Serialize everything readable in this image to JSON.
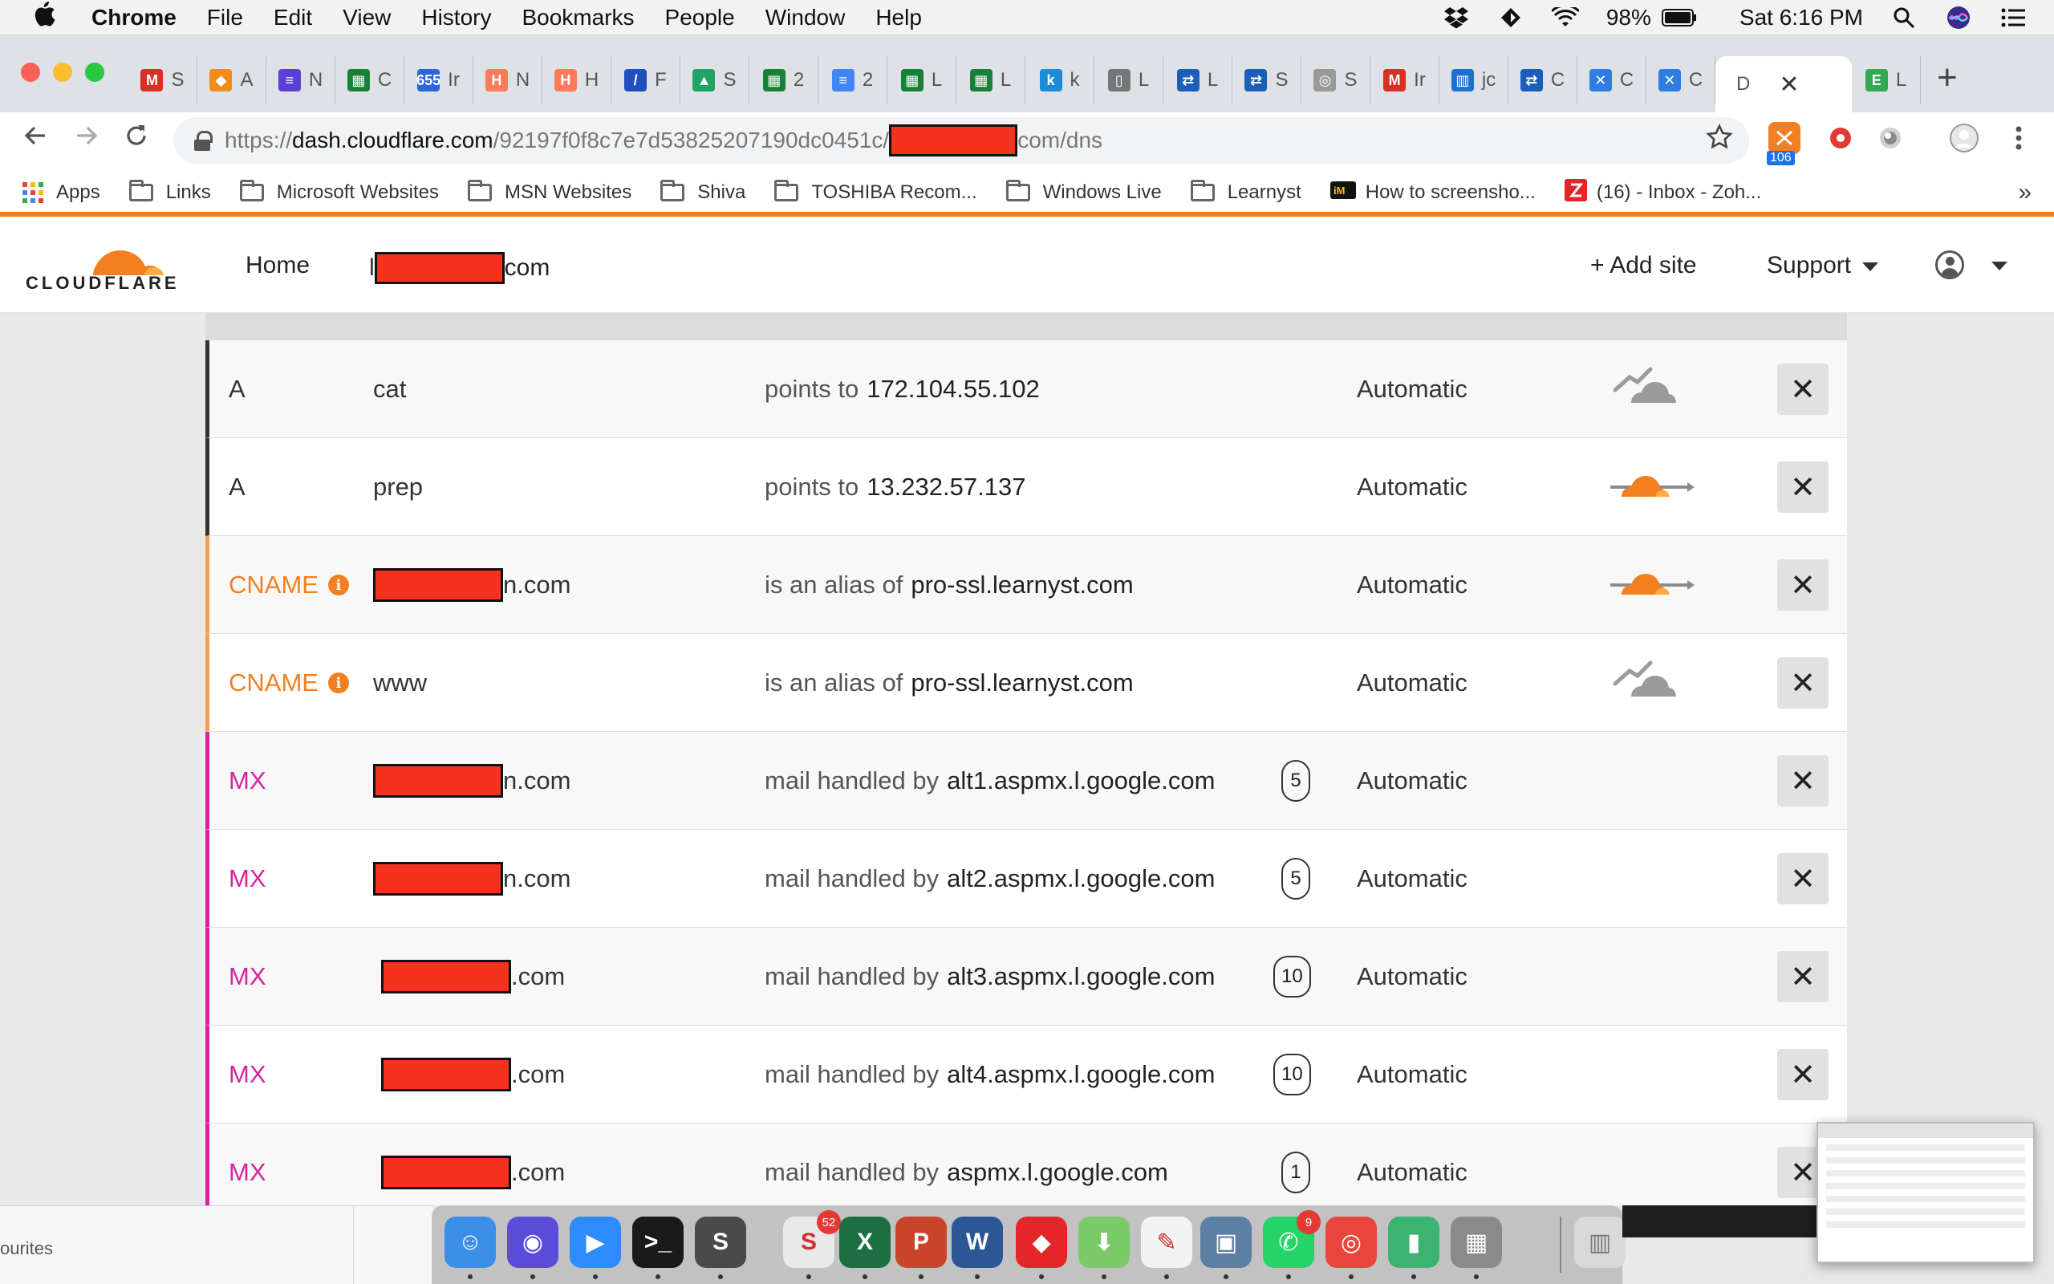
{
  "menubar": {
    "apple": "",
    "app": "Chrome",
    "items": [
      "File",
      "Edit",
      "View",
      "History",
      "Bookmarks",
      "People",
      "Window",
      "Help"
    ],
    "battery": "98%",
    "clock": "Sat 6:16 PM"
  },
  "tabs": [
    {
      "letter": "S",
      "fav": "M",
      "color": "#d93025"
    },
    {
      "letter": "A",
      "fav": "◆",
      "color": "#f08c1a"
    },
    {
      "letter": "N",
      "fav": "≡",
      "color": "#5b3fd6"
    },
    {
      "letter": "C",
      "fav": "▦",
      "color": "#188038"
    },
    {
      "letter": "Ir",
      "fav": "655",
      "color": "#2b67d6"
    },
    {
      "letter": "N",
      "fav": "H",
      "color": "#ff7a59"
    },
    {
      "letter": "H",
      "fav": "H",
      "color": "#ff7a59"
    },
    {
      "letter": "F",
      "fav": "/",
      "color": "#1f4fbf"
    },
    {
      "letter": "S",
      "fav": "▲",
      "color": "#1fa463"
    },
    {
      "letter": "2",
      "fav": "▦",
      "color": "#188038"
    },
    {
      "letter": "2",
      "fav": "≡",
      "color": "#4285f4"
    },
    {
      "letter": "L",
      "fav": "▦",
      "color": "#188038"
    },
    {
      "letter": "L",
      "fav": "▦",
      "color": "#188038"
    },
    {
      "letter": "k",
      "fav": "k",
      "color": "#1a8cd8"
    },
    {
      "letter": "L",
      "fav": "▯",
      "color": "#777777"
    },
    {
      "letter": "L",
      "fav": "⇄",
      "color": "#1c5fb8"
    },
    {
      "letter": "S",
      "fav": "⇄",
      "color": "#1c5fb8"
    },
    {
      "letter": "S",
      "fav": "◎",
      "color": "#999999"
    },
    {
      "letter": "Ir",
      "fav": "M",
      "color": "#d93025"
    },
    {
      "letter": "jc",
      "fav": "▥",
      "color": "#1f6fd1"
    },
    {
      "letter": "C",
      "fav": "⇄",
      "color": "#1c5fb8"
    },
    {
      "letter": "C",
      "fav": "✕",
      "color": "#2f7de1"
    },
    {
      "letter": "C",
      "fav": "✕",
      "color": "#2f7de1"
    }
  ],
  "active_tab": {
    "label": "D",
    "close": "✕"
  },
  "last_tab": {
    "letter": "L",
    "fav": "E",
    "color": "#34a853"
  },
  "new_tab": "+",
  "omnibox": {
    "scheme": "https://",
    "host": "dash.cloudflare.com",
    "path_start": "/92197f0f8c7e7d53825207190dc0451c/",
    "path_end": "com/dns"
  },
  "extensions": {
    "badge_count": "106"
  },
  "bookmarks": [
    {
      "label": "Apps",
      "type": "apps"
    },
    {
      "label": "Links",
      "type": "folder"
    },
    {
      "label": "Microsoft Websites",
      "type": "folder"
    },
    {
      "label": "MSN Websites",
      "type": "folder"
    },
    {
      "label": "Shiva",
      "type": "folder"
    },
    {
      "label": "TOSHIBA Recom...",
      "type": "folder"
    },
    {
      "label": "Windows Live",
      "type": "folder"
    },
    {
      "label": "Learnyst",
      "type": "folder"
    },
    {
      "label": "How to screensho...",
      "type": "im"
    },
    {
      "label": "(16) - Inbox - Zoh...",
      "type": "zoho"
    }
  ],
  "bookmarks_more": "»",
  "cloudflare": {
    "logo_text": "CLOUDFLARE",
    "nav_home": "Home",
    "site_suffix": "com",
    "add_site": "+ Add site",
    "support": "Support"
  },
  "dns_records": [
    {
      "type": "A",
      "name": "cat",
      "redacted": false,
      "value_prefix": "points to",
      "value": "172.104.55.102",
      "priority": "",
      "ttl": "Automatic",
      "proxy": "dns-only",
      "type_color": "#333333",
      "border": "#333333"
    },
    {
      "type": "A",
      "name": "prep",
      "redacted": false,
      "value_prefix": "points to",
      "value": "13.232.57.137",
      "priority": "",
      "ttl": "Automatic",
      "proxy": "proxied",
      "type_color": "#333333",
      "border": "#333333"
    },
    {
      "type": "CNAME",
      "name": "n.com",
      "redacted": true,
      "value_prefix": "is an alias of",
      "value": "pro-ssl.learnyst.com",
      "priority": "",
      "ttl": "Automatic",
      "proxy": "proxied",
      "type_color": "#f38020",
      "border": "#f6a04d"
    },
    {
      "type": "CNAME",
      "name": "www",
      "redacted": false,
      "value_prefix": "is an alias of",
      "value": "pro-ssl.learnyst.com",
      "priority": "",
      "ttl": "Automatic",
      "proxy": "dns-only",
      "type_color": "#f38020",
      "border": "#f6a04d"
    },
    {
      "type": "MX",
      "name": "n.com",
      "redacted": true,
      "value_prefix": "mail handled by",
      "value": "alt1.aspmx.l.google.com",
      "priority": "5",
      "ttl": "Automatic",
      "proxy": "",
      "type_color": "#d6249f",
      "border": "#d6249f"
    },
    {
      "type": "MX",
      "name": "n.com",
      "redacted": true,
      "value_prefix": "mail handled by",
      "value": "alt2.aspmx.l.google.com",
      "priority": "5",
      "ttl": "Automatic",
      "proxy": "",
      "type_color": "#d6249f",
      "border": "#d6249f"
    },
    {
      "type": "MX",
      "name": ".com",
      "redacted": true,
      "value_prefix": "mail handled by",
      "value": "alt3.aspmx.l.google.com",
      "priority": "10",
      "ttl": "Automatic",
      "proxy": "",
      "type_color": "#d6249f",
      "border": "#d6249f"
    },
    {
      "type": "MX",
      "name": ".com",
      "redacted": true,
      "value_prefix": "mail handled by",
      "value": "alt4.aspmx.l.google.com",
      "priority": "10",
      "ttl": "Automatic",
      "proxy": "",
      "type_color": "#d6249f",
      "border": "#d6249f"
    },
    {
      "type": "MX",
      "name": ".com",
      "redacted": true,
      "value_prefix": "mail handled by",
      "value": "aspmx.l.google.com",
      "priority": "1",
      "ttl": "Automatic",
      "proxy": "",
      "type_color": "#d6249f",
      "border": "#d6249f"
    }
  ],
  "delete_label": "✕",
  "finder_sidebar_text": "ourites",
  "dock": [
    {
      "name": "finder",
      "glyph": "☺",
      "color": "#3b8fe8",
      "badge": ""
    },
    {
      "name": "siri",
      "glyph": "◉",
      "color": "#5a4bd8",
      "badge": ""
    },
    {
      "name": "zoom",
      "glyph": "▶",
      "color": "#2d8cff",
      "badge": ""
    },
    {
      "name": "terminal",
      "glyph": ">_",
      "color": "#1a1a1a",
      "badge": ""
    },
    {
      "name": "sublime",
      "glyph": "S",
      "color": "#4a4a4a",
      "badge": ""
    },
    {
      "name": "slack",
      "glyph": "S",
      "color": "#e9e9e9",
      "badge": "52"
    },
    {
      "name": "excel",
      "glyph": "X",
      "color": "#1d6f42",
      "badge": ""
    },
    {
      "name": "powerpoint",
      "glyph": "P",
      "color": "#c9442b",
      "badge": ""
    },
    {
      "name": "word",
      "glyph": "W",
      "color": "#2b5797",
      "badge": ""
    },
    {
      "name": "anydesk",
      "glyph": "◆",
      "color": "#e4252a",
      "badge": ""
    },
    {
      "name": "installer",
      "glyph": "⬇",
      "color": "#7cc96a",
      "badge": ""
    },
    {
      "name": "textedit",
      "glyph": "✎",
      "color": "#f2f2f2",
      "badge": ""
    },
    {
      "name": "preview",
      "glyph": "▣",
      "color": "#5d7fa3",
      "badge": ""
    },
    {
      "name": "whatsapp",
      "glyph": "✆",
      "color": "#25d366",
      "badge": "9"
    },
    {
      "name": "chrome",
      "glyph": "◎",
      "color": "#e8453c",
      "badge": ""
    },
    {
      "name": "numbers",
      "glyph": "▮",
      "color": "#3cb371",
      "badge": ""
    },
    {
      "name": "calculator",
      "glyph": "▦",
      "color": "#8a8a8a",
      "badge": ""
    }
  ],
  "trash": {
    "glyph": "▥",
    "color": "#d9d9d9"
  },
  "colors": {
    "cf_orange": "#f38020",
    "redaction": "#f4321e",
    "mx_pink": "#d6249f",
    "proxy_grey": "#9b9b9b"
  }
}
